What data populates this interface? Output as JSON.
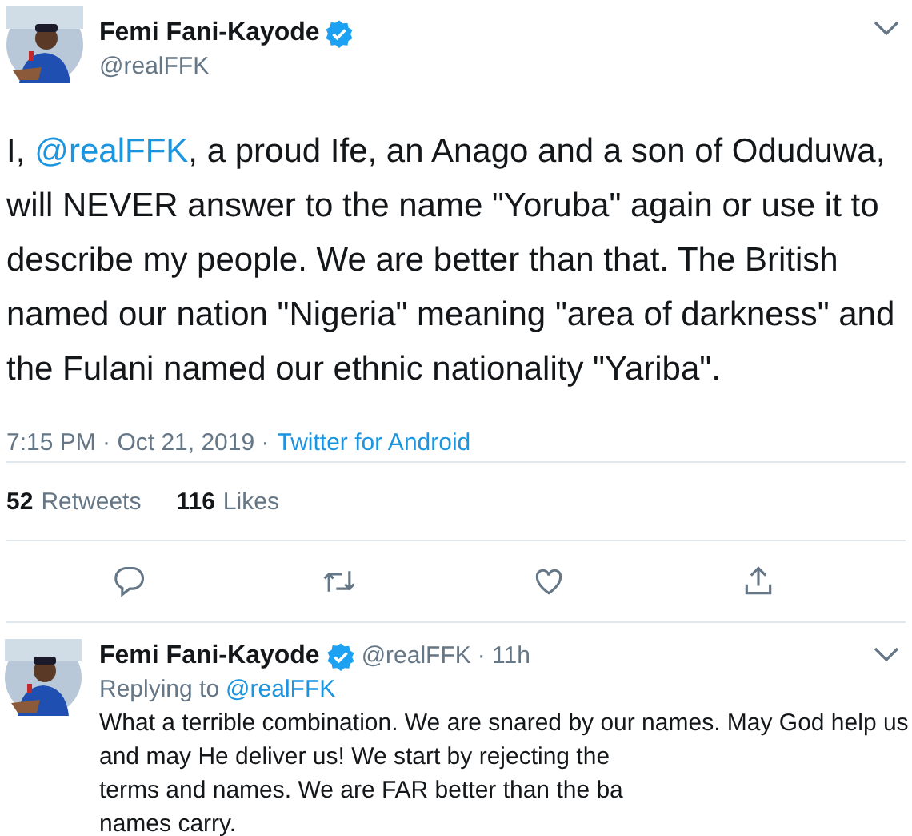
{
  "tweet": {
    "author": {
      "name": "Femi Fani-Kayode",
      "verified": true,
      "handle": "@realFFK"
    },
    "text_parts": [
      {
        "kind": "plain",
        "text": "I,"
      },
      {
        "kind": "mention",
        "text": "@realFFK"
      },
      {
        "kind": "plain",
        "text": ", a proud Ife, an Anago and a son of Oduduwa, will NEVER answer to the name \"Yoruba\" again or use it to describe my people. We are better than that. The British named our nation \"Nigeria\" meaning \"area of darkness\" and the Fulani named our ethnic nationality \"Yariba\"."
      }
    ],
    "time": "7:15 PM · Oct 21, 2019 ·",
    "source": "Twitter for Android",
    "stats": [
      {
        "count": "52",
        "label": "Retweets"
      },
      {
        "count": "116",
        "label": "Likes"
      }
    ],
    "actions": [
      {
        "kind": "reply"
      },
      {
        "kind": "retweet"
      },
      {
        "kind": "like"
      },
      {
        "kind": "share"
      }
    ]
  },
  "reply": {
    "author": {
      "name": "Femi Fani-Kayode",
      "verified": true,
      "handle": "@realFFK"
    },
    "age": "· 11h",
    "replying_label": "Replying to",
    "replying_to": "@realFFK",
    "lines": [
      "What a terrible combination. We are snared by our names. May God help us",
      "and may He deliver us! We start by rejecting the",
      "terms and names. We are FAR better than the ba",
      "names carry."
    ]
  }
}
